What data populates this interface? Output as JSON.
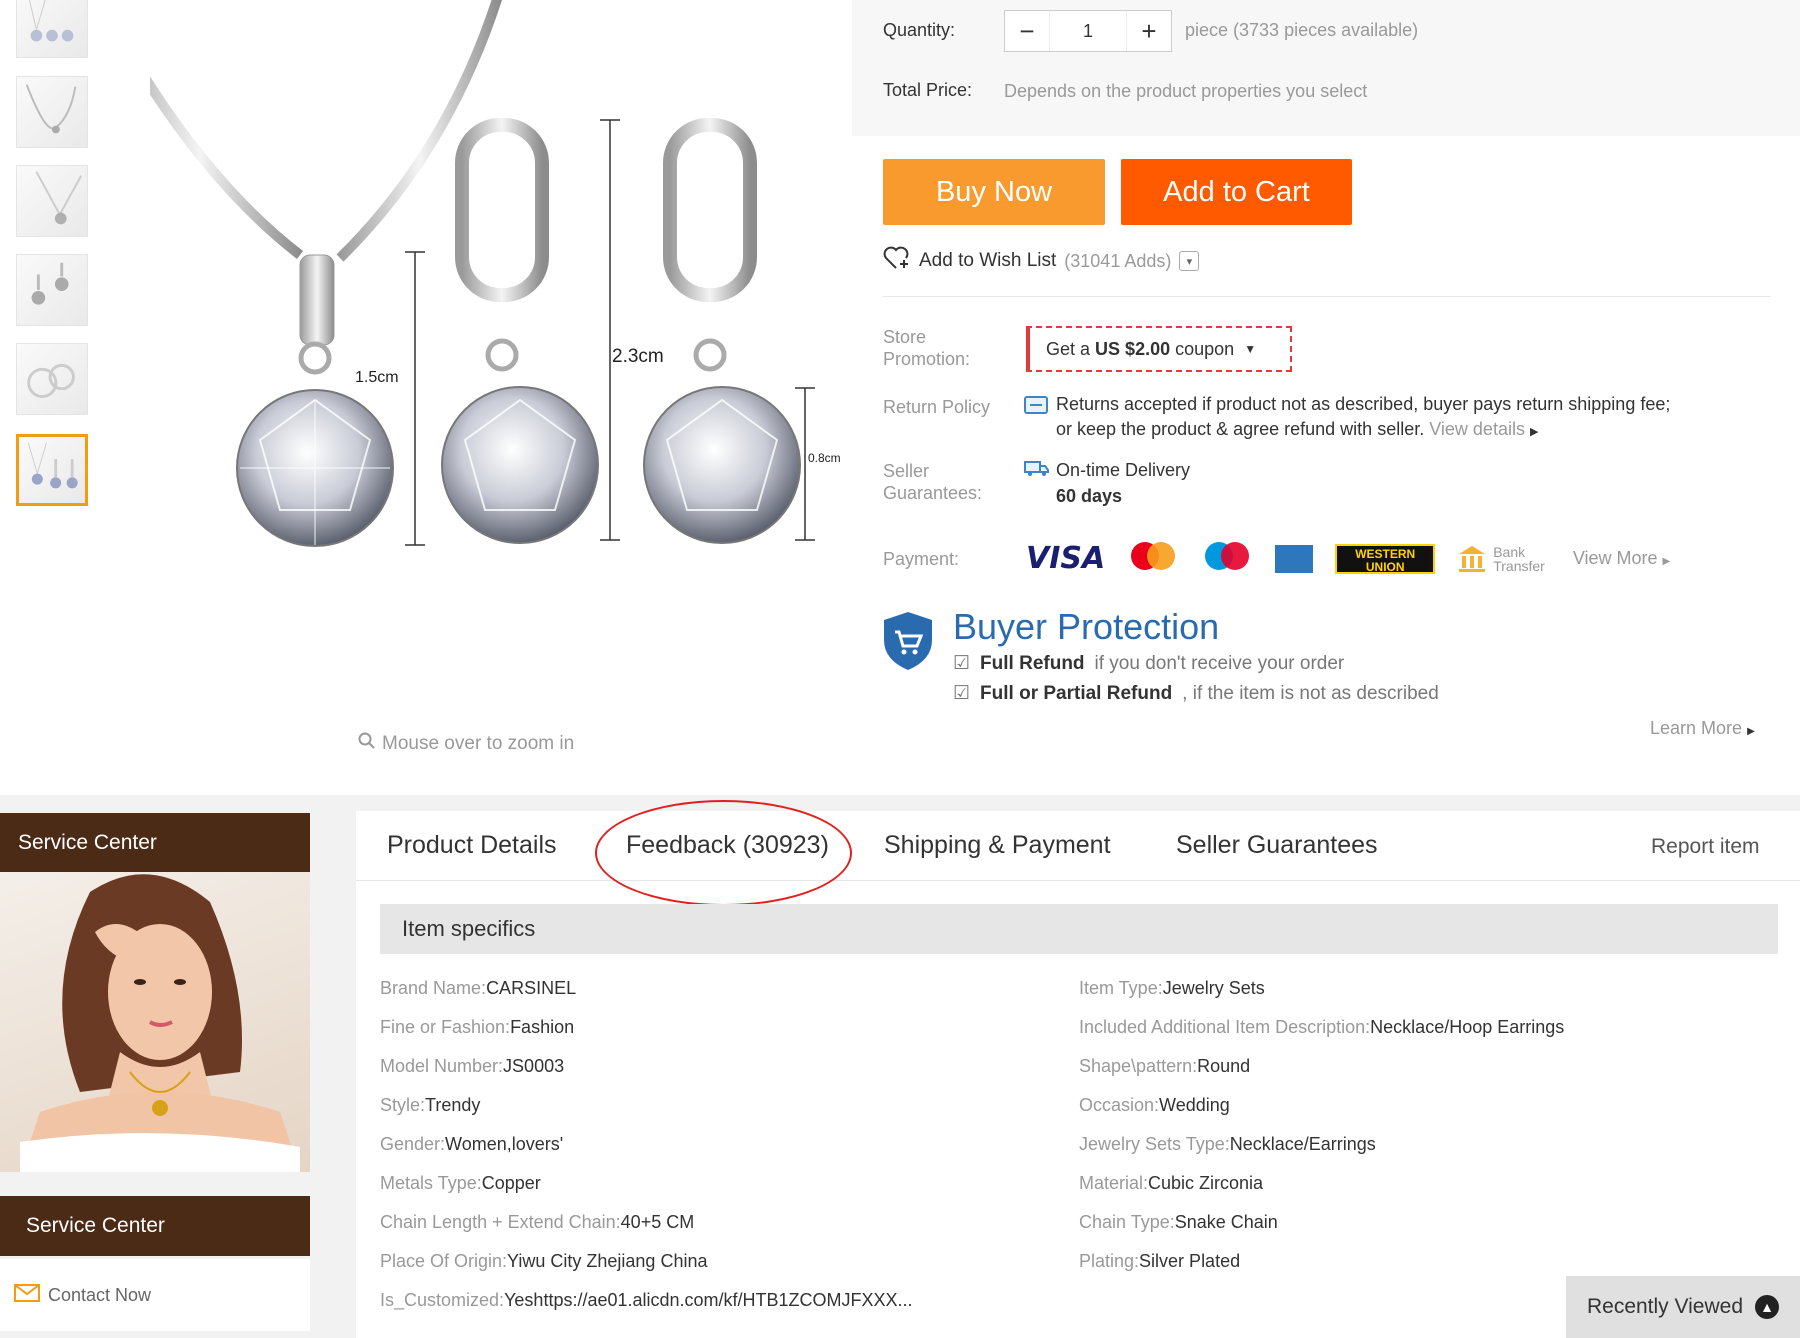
{
  "gallery": {
    "thumbnail_count": 6,
    "active_index": 5,
    "dimensions": [
      "1.5cm",
      "2.3cm",
      "0.8cm"
    ],
    "zoom_hint": "Mouse over to zoom in"
  },
  "purchase": {
    "quantity_label": "Quantity:",
    "quantity_value": "1",
    "minus": "−",
    "plus": "+",
    "availability": "piece (3733 pieces available)",
    "total_label": "Total Price:",
    "total_value": "Depends on the product properties you select",
    "buy_now": "Buy Now",
    "add_to_cart": "Add to Cart",
    "wishlist_label": "Add to Wish List",
    "wishlist_count": "(31041 Adds)"
  },
  "store": {
    "promotion_label_1": "Store",
    "promotion_label_2": "Promotion:",
    "coupon_prefix": "Get a",
    "coupon_amount": "US $2.00",
    "coupon_suffix": "coupon",
    "return_label": "Return Policy",
    "return_line1": "Returns accepted if product not as described, buyer pays return shipping fee;",
    "return_line2": "or keep the product & agree refund with seller.",
    "return_link": "View details",
    "guarantee_label_1": "Seller",
    "guarantee_label_2": "Guarantees:",
    "guarantee_item": "On-time Delivery",
    "guarantee_days": "60 days",
    "payment_label": "Payment:",
    "visa": "VISA",
    "western_union_1": "WESTERN",
    "western_union_2": "UNION",
    "bank_1": "Bank",
    "bank_2": "Transfer",
    "view_more": "View More"
  },
  "buyer_protection": {
    "title": "Buyer Protection",
    "full_refund": "Full Refund",
    "full_refund_rest": "if you don't receive your order",
    "partial_refund": "Full or Partial Refund",
    "partial_refund_rest": ", if the item is not as described",
    "learn_more": "Learn More"
  },
  "sidebar": {
    "service_center_1": "Service Center",
    "service_center_2": "Service Center",
    "contact": "Contact Now"
  },
  "tabs": {
    "product_details": "Product Details",
    "feedback": "Feedback (30923)",
    "shipping": "Shipping & Payment",
    "guarantees": "Seller Guarantees",
    "report": "Report item"
  },
  "specs": {
    "heading": "Item specifics",
    "left": [
      {
        "k": "Brand Name:",
        "v": "CARSINEL"
      },
      {
        "k": "Fine or Fashion:",
        "v": "Fashion"
      },
      {
        "k": "Model Number:",
        "v": "JS0003"
      },
      {
        "k": "Style:",
        "v": "Trendy"
      },
      {
        "k": "Gender:",
        "v": "Women,lovers'"
      },
      {
        "k": "Metals Type:",
        "v": "Copper"
      },
      {
        "k": "Chain Length + Extend Chain:",
        "v": "40+5 CM"
      },
      {
        "k": "Place Of Origin:",
        "v": "Yiwu City Zhejiang China"
      },
      {
        "k": "Is_Customized:",
        "v": "Yeshttps://ae01.alicdn.com/kf/HTB1ZCOMJFXXX..."
      }
    ],
    "right": [
      {
        "k": "Item Type:",
        "v": "Jewelry Sets"
      },
      {
        "k": "Included Additional Item Description:",
        "v": "Necklace/Hoop Earrings"
      },
      {
        "k": "Shape\\pattern:",
        "v": "Round"
      },
      {
        "k": "Occasion:",
        "v": "Wedding"
      },
      {
        "k": "Jewelry Sets Type:",
        "v": "Necklace/Earrings"
      },
      {
        "k": "Material:",
        "v": "Cubic Zirconia"
      },
      {
        "k": "Chain Type:",
        "v": "Snake Chain"
      },
      {
        "k": "Plating:",
        "v": "Silver Plated"
      }
    ]
  },
  "recently_viewed": "Recently Viewed",
  "colors": {
    "buy_now": "#f89a2d",
    "add_to_cart": "#ff5a00",
    "service_center": "#4b2a16",
    "protection": "#2a6bb0",
    "annotation_circle": "#e32020",
    "thumb_active": "#f39c12"
  }
}
